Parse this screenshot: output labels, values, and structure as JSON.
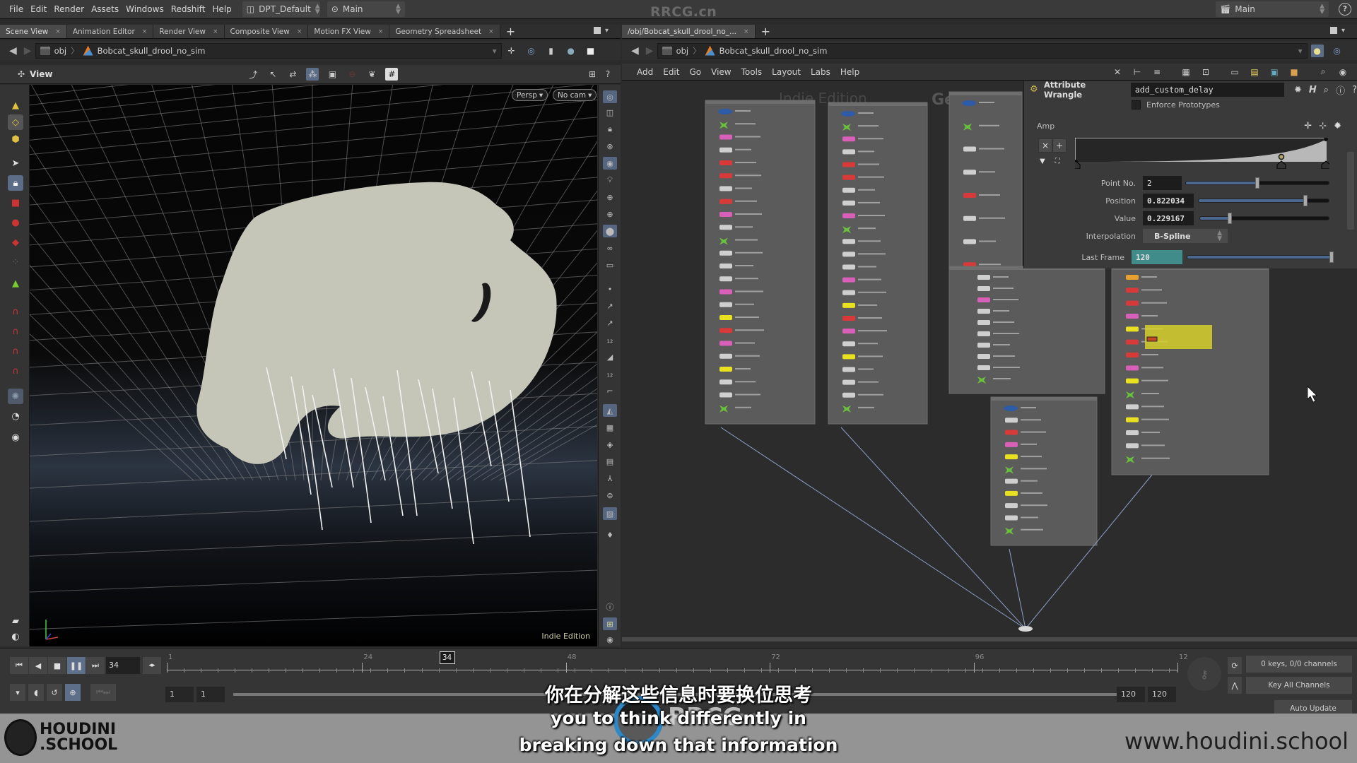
{
  "menubar": {
    "items": [
      "File",
      "Edit",
      "Render",
      "Assets",
      "Windows",
      "Redshift",
      "Help"
    ],
    "desktop": "DPT_Default",
    "context": "Main",
    "watermark": "RRCG.cn",
    "desk_right": "Main",
    "help": "?"
  },
  "left_pane": {
    "tabs": [
      {
        "label": "Scene View",
        "active": true
      },
      {
        "label": "Animation Editor"
      },
      {
        "label": "Render View"
      },
      {
        "label": "Composite View"
      },
      {
        "label": "Motion FX View"
      },
      {
        "label": "Geometry Spreadsheet"
      }
    ],
    "path": [
      "obj",
      "Bobcat_skull_drool_no_sim"
    ],
    "toolbar_label": "View",
    "view_persp": "Persp",
    "view_cam": "No cam",
    "indie_label": "Indie Edition"
  },
  "right_pane": {
    "tab": "/obj/Bobcat_skull_drool_no_...",
    "path": [
      "obj",
      "Bobcat_skull_drool_no_sim"
    ],
    "menu": [
      "Add",
      "Edit",
      "Go",
      "View",
      "Tools",
      "Layout",
      "Labs",
      "Help"
    ],
    "watermark_indie": "Indie Edition",
    "watermark_context": "Geometry"
  },
  "parameters": {
    "node_type": "Attribute Wrangle",
    "node_name": "add_custom_delay",
    "enforce_prototypes": "Enforce Prototypes",
    "enforce_checked": false,
    "ramp_label": "Amp",
    "point_no_label": "Point No.",
    "point_no": "2",
    "point_no_fraction": 0.5,
    "position_label": "Position",
    "position": "0.822034",
    "value_label": "Value",
    "value": "0.229167",
    "interp_label": "Interpolation",
    "interpolation": "B-Spline",
    "last_frame_label": "Last Frame",
    "last_frame": "120",
    "last_frame_fraction": 1.0
  },
  "timeline": {
    "current_frame": "34",
    "ruler_labels": [
      "1",
      "24",
      "48",
      "72",
      "96",
      "12"
    ],
    "range_start": "1",
    "range_start2": "1",
    "range_end": "120",
    "range_end2": "120",
    "keys_status": "0 keys, 0/0 channels",
    "key_all": "Key All Channels",
    "auto_update": "Auto Update"
  },
  "overlay": {
    "subtitle_cn": "你在分解这些信息时要换位思考",
    "subtitle_en1": "you to think differently in",
    "subtitle_en2": "breaking down that information",
    "logo_line1": "HOUDINI",
    "logo_line2": ".SCHOOL",
    "site": "www.houdini.school",
    "rrcg": "RRCG"
  }
}
